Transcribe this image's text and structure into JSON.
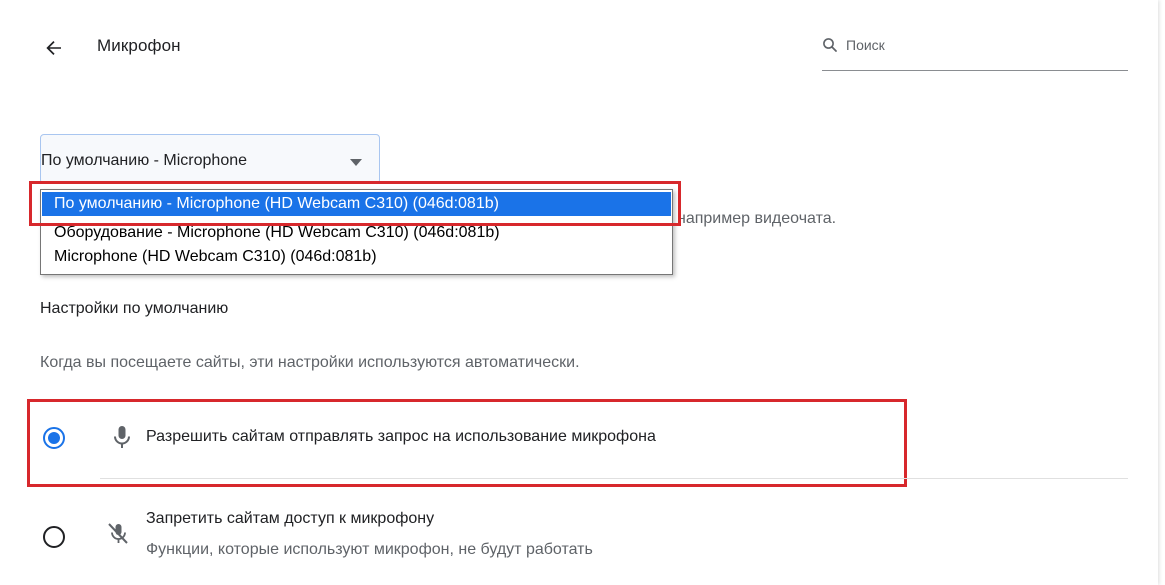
{
  "header": {
    "title": "Микрофон",
    "back_icon": "arrow-left-icon",
    "search_icon": "search-icon",
    "search_placeholder": "Поиск",
    "search_value": ""
  },
  "microphone_select": {
    "selected_value": "По умолчанию - Microphone",
    "arrow_icon": "caret-down-icon",
    "options": [
      "По умолчанию - Microphone (HD Webcam C310) (046d:081b)",
      "Оборудование - Microphone (HD Webcam C310) (046d:081b)",
      "Microphone (HD Webcam C310) (046d:081b)"
    ],
    "highlighted_option_index": 0
  },
  "microphone_description_tail": "например видеочата.",
  "defaults": {
    "heading": "Настройки по умолчанию",
    "description": "Когда вы посещаете сайты, эти настройки используются автоматически.",
    "allow": {
      "label": "Разрешить сайтам отправлять запрос на использование микрофона",
      "icon": "microphone-icon",
      "checked": true
    },
    "block": {
      "label": "Запретить сайтам доступ к микрофону",
      "sublabel": "Функции, которые используют микрофон, не будут работать",
      "icon": "microphone-off-icon",
      "checked": false
    }
  },
  "colors": {
    "accent": "#1a73e8",
    "annotation": "#d7282c",
    "text_primary": "#202124",
    "text_secondary": "#5f6368"
  }
}
